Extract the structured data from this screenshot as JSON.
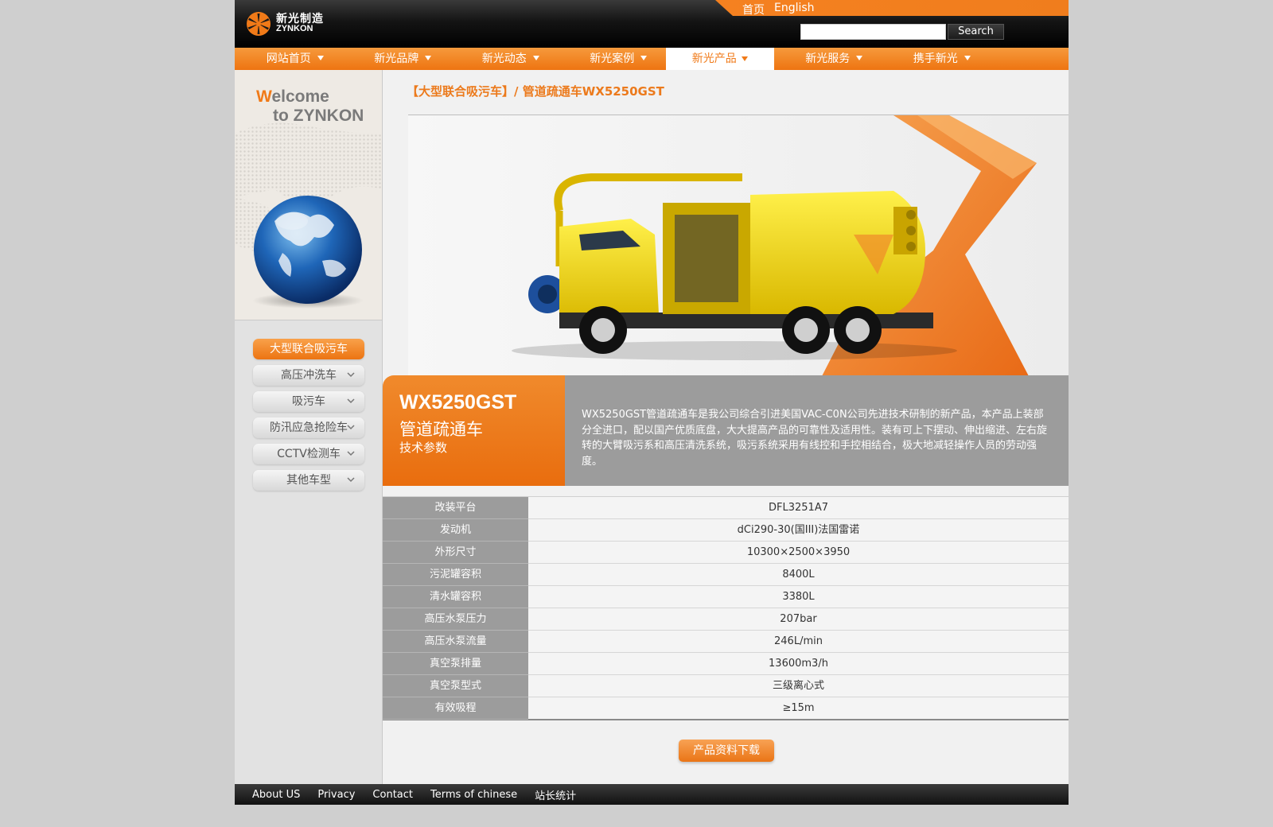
{
  "brand": {
    "name_cn": "新光制造",
    "name_en": "ZYNKON"
  },
  "header": {
    "lang_home": "首页",
    "lang_english": "English",
    "search_button": "Search",
    "search_value": ""
  },
  "nav": {
    "items": [
      "网站首页",
      "新光品牌",
      "新光动态",
      "新光案例",
      "新光产品",
      "新光服务",
      "携手新光"
    ],
    "active": "新光产品"
  },
  "welcome": {
    "line1_first": "W",
    "line1_rest": "elcome",
    "line2": "to ZYNKON"
  },
  "sidebar": {
    "items": [
      {
        "label": "大型联合吸污车"
      },
      {
        "label": "高压冲洗车"
      },
      {
        "label": "吸污车"
      },
      {
        "label": "防汛应急抢险车"
      },
      {
        "label": "CCTV检测车"
      },
      {
        "label": "其他车型"
      }
    ]
  },
  "breadcrumb": "【大型联合吸污车】/ 管道疏通车WX5250GST",
  "product": {
    "model": "WX5250GST",
    "name": "管道疏通车",
    "params_title": "技术参数",
    "description": "WX5250GST管道疏通车是我公司综合引进美国VAC-C0N公司先进技术研制的新产品，本产品上装部分全进口，配以国产优质底盘，大大提高产品的可靠性及适用性。装有可上下摆动、伸出缩进、左右旋转的大臂吸污系和高压清洗系统，吸污系统采用有线控和手控相结合，极大地减轻操作人员的劳动强度。"
  },
  "specs": [
    {
      "label": "改装平台",
      "value": "DFL3251A7"
    },
    {
      "label": "发动机",
      "value": "dCi290-30(国III)法国雷诺"
    },
    {
      "label": "外形尺寸",
      "value": "10300×2500×3950"
    },
    {
      "label": "污泥罐容积",
      "value": "8400L"
    },
    {
      "label": "清水罐容积",
      "value": "3380L"
    },
    {
      "label": "高压水泵压力",
      "value": "207bar"
    },
    {
      "label": "高压水泵流量",
      "value": "246L/min"
    },
    {
      "label": "真空泵排量",
      "value": "13600m3/h"
    },
    {
      "label": "真空泵型式",
      "value": "三级离心式"
    },
    {
      "label": "有效吸程",
      "value": "≥15m"
    }
  ],
  "download_label": "产品资料下载",
  "footer": {
    "links": [
      "About US",
      "Privacy",
      "Contact",
      "Terms of chinese",
      "站长统计"
    ]
  }
}
